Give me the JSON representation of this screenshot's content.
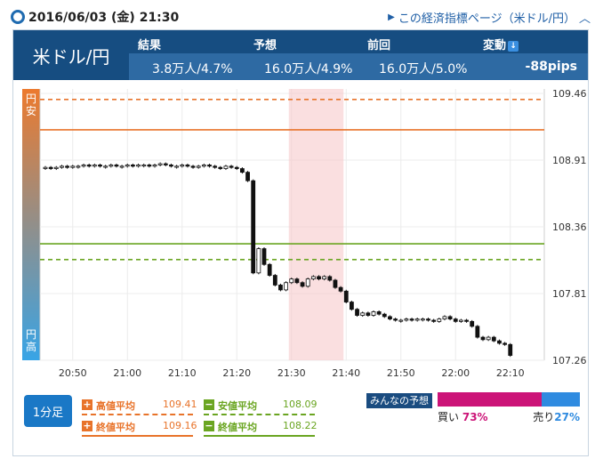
{
  "header": {
    "datetime": "2016/06/03 (金) 21:30",
    "link_text": "この経済指標ページ（米ドル/円）"
  },
  "banner": {
    "pair": "米ドル/円",
    "headers": {
      "result": "結果",
      "forecast": "予想",
      "previous": "前回",
      "change": "変動"
    },
    "values": {
      "result": "3.8万人/4.7%",
      "forecast": "16.0万人/4.9%",
      "previous": "16.0万人/5.0%",
      "change": "-88pips"
    }
  },
  "chart": {
    "side_top": "円安",
    "side_bottom": "円高",
    "y_ticks": [
      "109.46",
      "108.91",
      "108.36",
      "107.81",
      "107.26"
    ],
    "x_ticks": [
      "20:50",
      "21:00",
      "21:10",
      "21:20",
      "21:30",
      "21:40",
      "21:50",
      "22:00",
      "22:10"
    ]
  },
  "chart_data": {
    "type": "candlestick",
    "interval": "1分足",
    "ylim": [
      107.26,
      109.46
    ],
    "x_start": "20:45",
    "highlight": {
      "from": "21:30",
      "to": "21:40"
    },
    "reference_lines": [
      {
        "name": "高値平均",
        "value": 109.41,
        "style": "dashed",
        "color": "#e8732a"
      },
      {
        "name": "終値平均",
        "value": 109.16,
        "style": "solid",
        "color": "#e8732a"
      },
      {
        "name": "安値平均",
        "value": 108.09,
        "style": "dashed",
        "color": "#6aa521"
      },
      {
        "name": "終値平均",
        "value": 108.22,
        "style": "solid",
        "color": "#6aa521"
      }
    ],
    "candles": [
      [
        108.84,
        108.85
      ],
      [
        108.85,
        108.84
      ],
      [
        108.84,
        108.85
      ],
      [
        108.85,
        108.86
      ],
      [
        108.86,
        108.85
      ],
      [
        108.85,
        108.86
      ],
      [
        108.86,
        108.86
      ],
      [
        108.86,
        108.87
      ],
      [
        108.87,
        108.86
      ],
      [
        108.86,
        108.87
      ],
      [
        108.87,
        108.86
      ],
      [
        108.86,
        108.86
      ],
      [
        108.86,
        108.87
      ],
      [
        108.87,
        108.86
      ],
      [
        108.86,
        108.86
      ],
      [
        108.86,
        108.87
      ],
      [
        108.87,
        108.86
      ],
      [
        108.86,
        108.87
      ],
      [
        108.87,
        108.87
      ],
      [
        108.87,
        108.86
      ],
      [
        108.86,
        108.87
      ],
      [
        108.87,
        108.88
      ],
      [
        108.88,
        108.87
      ],
      [
        108.87,
        108.86
      ],
      [
        108.86,
        108.86
      ],
      [
        108.86,
        108.87
      ],
      [
        108.87,
        108.86
      ],
      [
        108.86,
        108.85
      ],
      [
        108.85,
        108.86
      ],
      [
        108.86,
        108.87
      ],
      [
        108.87,
        108.86
      ],
      [
        108.86,
        108.85
      ],
      [
        108.85,
        108.84
      ],
      [
        108.84,
        108.86
      ],
      [
        108.86,
        108.85
      ],
      [
        108.85,
        108.84
      ],
      [
        108.84,
        108.81
      ],
      [
        108.81,
        108.74
      ],
      [
        108.74,
        107.98
      ],
      [
        107.98,
        108.18
      ],
      [
        108.18,
        108.05
      ],
      [
        108.05,
        107.96
      ],
      [
        107.96,
        107.88
      ],
      [
        107.88,
        107.84
      ],
      [
        107.84,
        107.9
      ],
      [
        107.9,
        107.93
      ],
      [
        107.93,
        107.9
      ],
      [
        107.9,
        107.87
      ],
      [
        107.87,
        107.93
      ],
      [
        107.93,
        107.95
      ],
      [
        107.95,
        107.93
      ],
      [
        107.93,
        107.95
      ],
      [
        107.95,
        107.92
      ],
      [
        107.92,
        107.86
      ],
      [
        107.86,
        107.83
      ],
      [
        107.83,
        107.74
      ],
      [
        107.74,
        107.68
      ],
      [
        107.68,
        107.63
      ],
      [
        107.63,
        107.65
      ],
      [
        107.65,
        107.63
      ],
      [
        107.63,
        107.66
      ],
      [
        107.66,
        107.64
      ],
      [
        107.64,
        107.62
      ],
      [
        107.62,
        107.6
      ],
      [
        107.6,
        107.59
      ],
      [
        107.59,
        107.59
      ],
      [
        107.59,
        107.6
      ],
      [
        107.6,
        107.59
      ],
      [
        107.59,
        107.6
      ],
      [
        107.6,
        107.6
      ],
      [
        107.6,
        107.59
      ],
      [
        107.59,
        107.58
      ],
      [
        107.58,
        107.6
      ],
      [
        107.6,
        107.62
      ],
      [
        107.62,
        107.6
      ],
      [
        107.6,
        107.58
      ],
      [
        107.58,
        107.59
      ],
      [
        107.59,
        107.58
      ],
      [
        107.58,
        107.54
      ],
      [
        107.54,
        107.45
      ],
      [
        107.45,
        107.43
      ],
      [
        107.43,
        107.45
      ],
      [
        107.45,
        107.42
      ],
      [
        107.42,
        107.4
      ],
      [
        107.4,
        107.39
      ],
      [
        107.39,
        107.3
      ]
    ]
  },
  "legend": {
    "period_button": "1分足",
    "high_avg": {
      "label": "高値平均",
      "value": "109.41"
    },
    "close_avg_up": {
      "label": "終値平均",
      "value": "109.16"
    },
    "low_avg": {
      "label": "安値平均",
      "value": "108.09"
    },
    "close_avg_down": {
      "label": "終値平均",
      "value": "108.22"
    },
    "colors": {
      "orange": "#e8732a",
      "green": "#6aa521",
      "navy": "#164d81",
      "buy": "#cc1478",
      "sell": "#2f8be0"
    }
  },
  "forecast": {
    "title": "みんなの予想",
    "buy_label": "買い",
    "buy_pct": "73%",
    "sell_label": "売り",
    "sell_pct": "27%",
    "buy_fraction": 0.73
  }
}
